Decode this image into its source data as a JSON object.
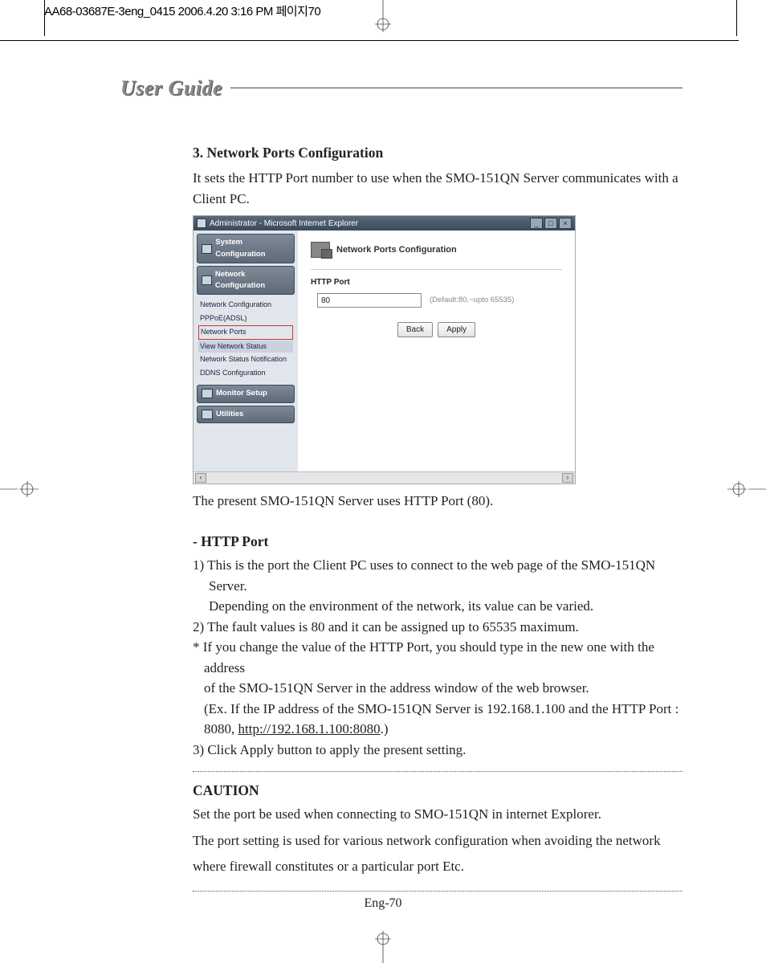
{
  "print_header": "AA68-03687E-3eng_0415  2006.4.20 3:16 PM  페이지70",
  "guide_title": "User Guide",
  "section": {
    "heading": "3. Network Ports Configuration",
    "intro": "It sets the HTTP Port number to use when the SMO-151QN Server communicates with a Client PC.",
    "after_figure": "The present SMO-151QN Server uses HTTP Port (80)."
  },
  "figure": {
    "window_title": "Administrator - Microsoft Internet Explorer",
    "sidebar": {
      "btn_system": "System Configuration",
      "btn_network": "Network Configuration",
      "sub_items": [
        "Network Configuration",
        "PPPoE(ADSL)",
        "Network Ports",
        "View Network Status",
        "Network Status Notification",
        "DDNS Configuration"
      ],
      "btn_monitor": "Monitor Setup",
      "btn_utilities": "Utilities"
    },
    "panel": {
      "title": "Network Ports Configuration",
      "field_label": "HTTP Port",
      "field_value": "80",
      "field_hint": "(Default:80,~upto 65535)",
      "btn_back": "Back",
      "btn_apply": "Apply"
    }
  },
  "http_port": {
    "heading": "- HTTP Port",
    "item1a": "1) This is the port the Client PC uses to connect to the web page of the SMO-151QN Server.",
    "item1b": "Depending on the environment of the network, its value can be varied.",
    "item2": "2) The fault values is 80 and it can be assigned up to 65535 maximum.",
    "star1": "* If you change the value of the HTTP Port, you should type in the new one with the address",
    "star2": "of the SMO-151QN Server in the address window of the web browser.",
    "star3a": "(Ex. If the IP address of the SMO-151QN Server is 192.168.1.100 and the HTTP Port :",
    "star3b_prefix": "8080, ",
    "star3b_url": "http://192.168.1.100:8080",
    "star3b_suffix": ".)",
    "item3": "3) Click Apply button to apply the present setting."
  },
  "caution": {
    "title": "CAUTION",
    "line1": "Set the port be used when connecting to SMO-151QN in internet Explorer.",
    "line2": "The port setting is used for various network configuration when avoiding the network where firewall constitutes or a particular port Etc."
  },
  "page_number": "Eng-70"
}
